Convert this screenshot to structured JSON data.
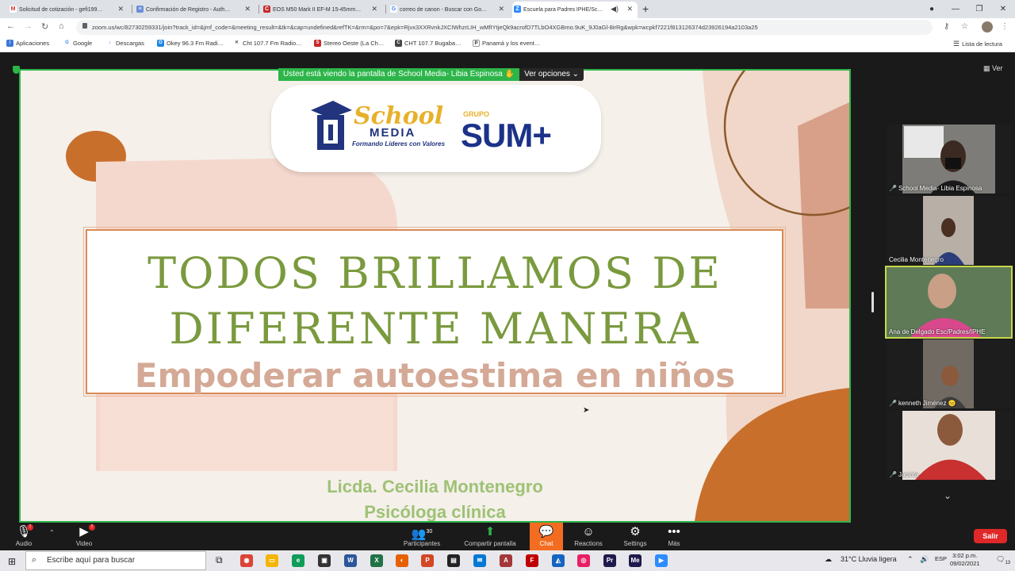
{
  "browser": {
    "tabs": [
      {
        "title": "Solicitud de cotización - gefi199…",
        "icon": "gmail-icon",
        "color": "#d93025",
        "glyph": "M"
      },
      {
        "title": "Confirmación de Registro - Auth…",
        "icon": "doc-icon",
        "color": "#6a8fd8",
        "glyph": "≡"
      },
      {
        "title": "EOS M50 Mark II EF-M 15-45mm…",
        "icon": "canon-icon",
        "color": "#c62828",
        "glyph": "C"
      },
      {
        "title": "correo de canon - Buscar con Go…",
        "icon": "google-icon",
        "color": "#4285f4",
        "glyph": "G"
      },
      {
        "title": "Escuela para Padres IPHE/Sc…",
        "icon": "zoom-icon",
        "color": "#2d8cff",
        "glyph": "Z"
      }
    ],
    "new_tab": "+",
    "url": "zoom.us/wc/82730259331/join?track_id=&jmf_code=&meeting_result=&tk=&cap=undefined&refTK=&rm=&po=7&epk=Rjvx3XXRvnkJXCIWhzrLIH_wMfIYtjeQk9acrofD7TLbO4XGBmo.9uK_9J0aGl-8irRg&wpk=wcpkf7221f813126374d23926194a2103a25",
    "bookmarks": [
      {
        "label": "Aplicaciones",
        "icon": "apps-grid-icon",
        "color": "#3c78d8",
        "glyph": "⁝"
      },
      {
        "label": "Google",
        "icon": "google-icon",
        "color": "#4285f4",
        "glyph": "G"
      },
      {
        "label": "Descargas",
        "icon": "download-icon",
        "color": "#1a73e8",
        "glyph": "↓"
      },
      {
        "label": "Okey 96.3 Fm Radi…",
        "icon": "radio-icon",
        "color": "#1e88e5",
        "glyph": "O"
      },
      {
        "label": "Cht 107.7 Fm Radio…",
        "icon": "radio-tower-icon",
        "color": "#555",
        "glyph": "✕"
      },
      {
        "label": "Stereo Oeste (La Ch…",
        "icon": "radio-icon",
        "color": "#c62828",
        "glyph": "S"
      },
      {
        "label": "CHT 107.7 Bugaba…",
        "icon": "radio-icon",
        "color": "#444",
        "glyph": "C"
      },
      {
        "label": "Panamá y los event…",
        "icon": "p-icon",
        "color": "#222",
        "glyph": "P"
      }
    ],
    "reading_list": "Lista de lectura"
  },
  "zoom": {
    "share_banner": "Usted está viendo la pantalla de School Media- Libia Espinosa",
    "view_options": "Ver opciones",
    "ver_button": "Ver",
    "participants": [
      {
        "name": "School Media- Libia Espinosa",
        "muted": true,
        "bg": "#7d7c78"
      },
      {
        "name": "Cecilia Montenegro",
        "muted": false,
        "bg": "#b8b0a6"
      },
      {
        "name": "Ana de Delgado Esc/Padres/IPHE",
        "muted": false,
        "bg": "#5e7a57"
      },
      {
        "name": "kenneth Jiménez 😐",
        "muted": true,
        "bg": "#706a62"
      },
      {
        "name": "Jacinta",
        "muted": true,
        "bg": "#c93030"
      }
    ],
    "toolbar": {
      "audio": "Audio",
      "video": "Video",
      "participants": "Participantes",
      "participants_count": "30",
      "share": "Compartir pantalla",
      "chat": "Chat",
      "reactions": "Reactions",
      "settings": "Settings",
      "more": "Más",
      "leave": "Salir"
    }
  },
  "slide": {
    "logo_school": "School",
    "logo_media": "MEDIA",
    "logo_tagline": "Formando Líderes con Valores",
    "logo_grupo": "GRUPO",
    "logo_sum": "SUM+",
    "title_line1": "TODOS BRILLAMOS DE",
    "title_line2": "DIFERENTE MANERA",
    "subtitle": "Empoderar autoestima en niños",
    "presenter": "Licda. Cecilia Montenegro",
    "presenter_role": "Psicóloga clínica"
  },
  "taskbar": {
    "search_placeholder": "Escribe aquí para buscar",
    "weather": "31°C  Lluvia ligera",
    "lang": "ESP",
    "time": "3:02 p.m.",
    "date": "09/02/2021",
    "notifications": "13",
    "apps": [
      {
        "icon": "chrome-icon",
        "color": "#db4437",
        "glyph": "◉"
      },
      {
        "icon": "file-explorer-icon",
        "color": "#f4b400",
        "glyph": "▭"
      },
      {
        "icon": "edge-icon",
        "color": "#0f9d58",
        "glyph": "e"
      },
      {
        "icon": "store-icon",
        "color": "#333",
        "glyph": "▣"
      },
      {
        "icon": "word-icon",
        "color": "#2b579a",
        "glyph": "W"
      },
      {
        "icon": "excel-icon",
        "color": "#217346",
        "glyph": "X"
      },
      {
        "icon": "firefox-icon",
        "color": "#e66000",
        "glyph": "◐"
      },
      {
        "icon": "powerpoint-icon",
        "color": "#d24726",
        "glyph": "P"
      },
      {
        "icon": "media-icon",
        "color": "#222",
        "glyph": "▤"
      },
      {
        "icon": "mail-icon",
        "color": "#0078d4",
        "glyph": "✉"
      },
      {
        "icon": "access-icon",
        "color": "#a4373a",
        "glyph": "A"
      },
      {
        "icon": "filezilla-icon",
        "color": "#bf0000",
        "glyph": "F"
      },
      {
        "icon": "upload-icon",
        "color": "#1565c0",
        "glyph": "◭"
      },
      {
        "icon": "photos-icon",
        "color": "#e91e63",
        "glyph": "◎"
      },
      {
        "icon": "premiere-icon",
        "color": "#1f1a4d",
        "glyph": "Pr"
      },
      {
        "icon": "media-encoder-icon",
        "color": "#1f1a4d",
        "glyph": "Me"
      },
      {
        "icon": "zoom-icon",
        "color": "#2d8cff",
        "glyph": "▶"
      }
    ]
  }
}
